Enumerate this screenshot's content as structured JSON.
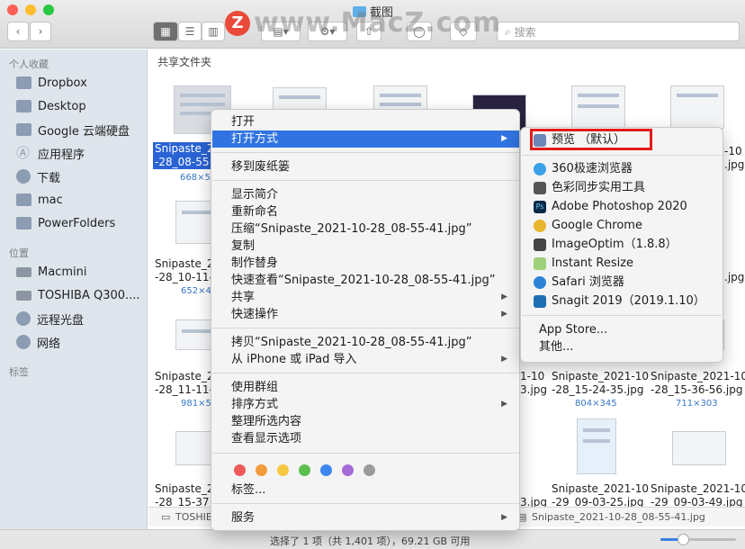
{
  "window": {
    "title": "截图",
    "watermark": "www.MacZ.com",
    "search_placeholder": "搜索"
  },
  "sidebar": {
    "favorites_header": "个人收藏",
    "favorites": [
      {
        "label": "Dropbox",
        "icon": "folder-icon"
      },
      {
        "label": "Desktop",
        "icon": "folder-icon"
      },
      {
        "label": "Google 云端硬盘",
        "icon": "folder-icon"
      },
      {
        "label": "应用程序",
        "icon": "applications-icon"
      },
      {
        "label": "下载",
        "icon": "download-icon"
      },
      {
        "label": "mac",
        "icon": "folder-icon"
      },
      {
        "label": "PowerFolders",
        "icon": "folder-icon"
      }
    ],
    "locations_header": "位置",
    "locations": [
      {
        "label": "Macmini",
        "icon": "computer-icon"
      },
      {
        "label": "TOSHIBA Q300....",
        "icon": "disk-icon"
      },
      {
        "label": "远程光盘",
        "icon": "disc-icon"
      },
      {
        "label": "网络",
        "icon": "network-icon"
      }
    ],
    "tags_header": "标签"
  },
  "content": {
    "section_title": "共享文件夹",
    "selected_name_1": "Snipaste_2",
    "selected_name_2": "-28_08-55",
    "selected_size": "668×5",
    "files": [
      {
        "name1": "Snipaste_2",
        "name2": "-28_10-11-",
        "size": "652×4"
      },
      {
        "name1": "Snipaste_2",
        "name2": "-28_11-11-",
        "size": "981×5"
      },
      {
        "name1": "Snipaste_2",
        "name2": "-28_15-37",
        "size": ""
      },
      {
        "name1": "Snipaste_2021-10",
        "name2": "-28_15-24-35.jpg",
        "size": "804×345"
      },
      {
        "name1": "Snipaste_2021-10",
        "name2": "-28_15-36-56.jpg",
        "size": "711×303"
      },
      {
        "name1": "Snipaste_2021-10",
        "name2": "-29_09-03-25.jpg",
        "size": ""
      },
      {
        "name1": "Snipaste_2021-10",
        "name2": "-29_09-03-49.jpg",
        "size": ""
      }
    ],
    "partial_labels": {
      "r1_c6": "-10",
      "r1_c6b": ".jpg",
      "r2_c6": ".jpg",
      "r3_c4a": "1-10",
      "r3_c4b": "3.jpg",
      "r4_c4b": "3.jpg"
    }
  },
  "pathbar": {
    "drive": "TOSHIBA",
    "file": "Snipaste_2021-10-28_08-55-41.jpg"
  },
  "status": {
    "text": "选择了 1 项（共 1,401 项），69.21 GB 可用",
    "zoom_level": 0.3
  },
  "context_menu": {
    "items": [
      {
        "label": "打开"
      },
      {
        "label": "打开方式",
        "submenu": true,
        "highlighted": true
      },
      {
        "label": "移到废纸篓"
      },
      {
        "label": "显示简介"
      },
      {
        "label": "重新命名"
      },
      {
        "label": "压缩“Snipaste_2021-10-28_08-55-41.jpg”"
      },
      {
        "label": "复制"
      },
      {
        "label": "制作替身"
      },
      {
        "label": "快速查看“Snipaste_2021-10-28_08-55-41.jpg”"
      },
      {
        "label": "共享",
        "submenu": true
      },
      {
        "label": "快速操作",
        "submenu": true
      },
      {
        "label": "拷贝“Snipaste_2021-10-28_08-55-41.jpg”"
      },
      {
        "label": "从 iPhone 或 iPad 导入",
        "submenu": true
      },
      {
        "label": "使用群组"
      },
      {
        "label": "排序方式",
        "submenu": true
      },
      {
        "label": "整理所选内容"
      },
      {
        "label": "查看显示选项"
      },
      {
        "label": "标签..."
      },
      {
        "label": "服务",
        "submenu": true
      }
    ],
    "tag_colors": [
      "#ee5a5a",
      "#f39a3a",
      "#f5c842",
      "#5bbf4f",
      "#3d86f0",
      "#a66ad8",
      "#9b9b9b"
    ]
  },
  "open_with": {
    "items": [
      {
        "label": "预览 （默认）",
        "icon_color": "#6a86b8",
        "icon": "preview-icon"
      },
      {
        "label": "360极速浏览器",
        "icon_color": "#3aa1e8",
        "icon": "browser-360-icon"
      },
      {
        "label": "色彩同步实用工具",
        "icon_color": "#555555",
        "icon": "colorsync-icon"
      },
      {
        "label": "Adobe Photoshop 2020",
        "icon_color": "#0b2a4a",
        "icon": "photoshop-icon"
      },
      {
        "label": "Google Chrome",
        "icon_color": "#e8b52e",
        "icon": "chrome-icon"
      },
      {
        "label": "ImageOptim（1.8.8）",
        "icon_color": "#444444",
        "icon": "imageoptim-icon"
      },
      {
        "label": "Instant Resize",
        "icon_color": "#9fd07a",
        "icon": "instant-resize-icon"
      },
      {
        "label": "Safari 浏览器",
        "icon_color": "#2d83d8",
        "icon": "safari-icon"
      },
      {
        "label": "Snagit 2019（2019.1.10）",
        "icon_color": "#1f6fb5",
        "icon": "snagit-icon"
      },
      {
        "label": "App Store..."
      },
      {
        "label": "其他..."
      }
    ]
  }
}
